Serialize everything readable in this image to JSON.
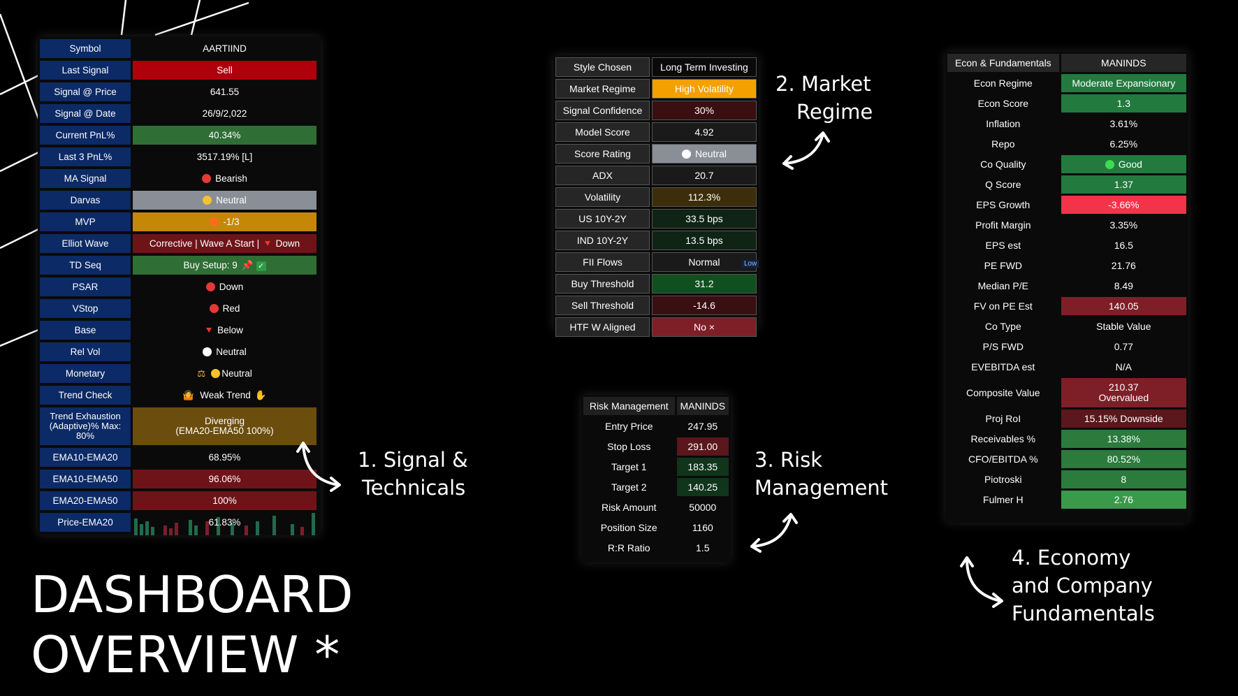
{
  "title_line1": "DASHBOARD",
  "title_line2": "OVERVIEW *",
  "captions": {
    "c1a": "1. Signal &",
    "c1b": "Technicals",
    "c2a": "2. Market",
    "c2b": "Regime",
    "c3a": "3. Risk",
    "c3b": "Management",
    "c4a": "4. Economy",
    "c4b": "and Company",
    "c4c": "Fundamentals"
  },
  "signal_table": {
    "header": {
      "label": "Symbol",
      "value": "AARTIIND"
    },
    "rows": [
      {
        "label": "Last Signal",
        "value": "Sell"
      },
      {
        "label": "Signal @ Price",
        "value": "641.55"
      },
      {
        "label": "Signal @ Date",
        "value": "26/9/2,022"
      },
      {
        "label": "Current PnL%",
        "value": "40.34%"
      },
      {
        "label": "Last 3 PnL%",
        "value": "3517.19% [L]"
      },
      {
        "label": "MA Signal",
        "value": "Bearish"
      },
      {
        "label": "Darvas",
        "value": "Neutral"
      },
      {
        "label": "MVP",
        "value": "-1/3"
      },
      {
        "label": "Elliot Wave",
        "value": "Corrective | Wave A Start |",
        "extra": "Down"
      },
      {
        "label": "TD Seq",
        "value": "Buy Setup: 9"
      },
      {
        "label": "PSAR",
        "value": "Down"
      },
      {
        "label": "VStop",
        "value": "Red"
      },
      {
        "label": "Base",
        "value": "Below"
      },
      {
        "label": "Rel Vol",
        "value": "Neutral"
      },
      {
        "label": "Monetary",
        "value": "Neutral"
      },
      {
        "label": "Trend Check",
        "value": "Weak Trend"
      },
      {
        "label": "Trend Exhaustion (Adaptive)% Max: 80%",
        "value": "Diverging\n(EMA20-EMA50 100%)"
      },
      {
        "label": "EMA10-EMA20",
        "value": "68.95%"
      },
      {
        "label": "EMA10-EMA50",
        "value": "96.06%"
      },
      {
        "label": "EMA20-EMA50",
        "value": "100%"
      },
      {
        "label": "Price-EMA20",
        "value": "61.83%"
      }
    ]
  },
  "regime_table": {
    "rows": [
      {
        "label": "Style Chosen",
        "value": "Long Term Investing"
      },
      {
        "label": "Market Regime",
        "value": "High Volatility"
      },
      {
        "label": "Signal Confidence",
        "value": "30%"
      },
      {
        "label": "Model Score",
        "value": "4.92"
      },
      {
        "label": "Score Rating",
        "value": "Neutral"
      },
      {
        "label": "ADX",
        "value": "20.7"
      },
      {
        "label": "Volatility",
        "value": "112.3%"
      },
      {
        "label": "US 10Y-2Y",
        "value": "33.5 bps"
      },
      {
        "label": "IND 10Y-2Y",
        "value": "13.5 bps"
      },
      {
        "label": "FII Flows",
        "value": "Normal"
      },
      {
        "label": "Buy Threshold",
        "value": "31.2"
      },
      {
        "label": "Sell Threshold",
        "value": "-14.6"
      },
      {
        "label": "HTF W Aligned",
        "value": "No ×"
      }
    ],
    "low_tag": "Low"
  },
  "risk_table": {
    "header": {
      "label": "Risk Management",
      "value": "MANINDS"
    },
    "rows": [
      {
        "label": "Entry Price",
        "value": "247.95"
      },
      {
        "label": "Stop Loss",
        "value": "291.00"
      },
      {
        "label": "Target 1",
        "value": "183.35"
      },
      {
        "label": "Target 2",
        "value": "140.25"
      },
      {
        "label": "Risk Amount",
        "value": "50000"
      },
      {
        "label": "Position Size",
        "value": "1160"
      },
      {
        "label": "R:R Ratio",
        "value": "1.5"
      }
    ]
  },
  "econ_table": {
    "header": {
      "label": "Econ & Fundamentals",
      "value": "MANINDS"
    },
    "rows": [
      {
        "label": "Econ Regime",
        "value": "Moderate Expansionary"
      },
      {
        "label": "Econ Score",
        "value": "1.3"
      },
      {
        "label": "Inflation",
        "value": "3.61%"
      },
      {
        "label": "Repo",
        "value": "6.25%"
      },
      {
        "label": "Co Quality",
        "value": "Good"
      },
      {
        "label": "Q Score",
        "value": "1.37"
      },
      {
        "label": "EPS Growth",
        "value": "-3.66%"
      },
      {
        "label": "Profit Margin",
        "value": "3.35%"
      },
      {
        "label": "EPS est",
        "value": "16.5"
      },
      {
        "label": "PE FWD",
        "value": "21.76"
      },
      {
        "label": "Median P/E",
        "value": "8.49"
      },
      {
        "label": "FV on PE Est",
        "value": "140.05"
      },
      {
        "label": "Co Type",
        "value": "Stable Value"
      },
      {
        "label": "P/S FWD",
        "value": "0.77"
      },
      {
        "label": "EVEBITDA est",
        "value": "N/A"
      },
      {
        "label": "Composite Value",
        "value": "210.37\nOvervalued"
      },
      {
        "label": "Proj RoI",
        "value": "15.15% Downside"
      },
      {
        "label": "Receivables %",
        "value": "13.38%"
      },
      {
        "label": "CFO/EBITDA %",
        "value": "80.52%"
      },
      {
        "label": "Piotroski",
        "value": "8"
      },
      {
        "label": "Fulmer H",
        "value": "2.76"
      }
    ]
  },
  "colors": {
    "label_blue": "#0c2a66",
    "sell_red": "#b0000b",
    "pnl_green": "#2f6e35",
    "neutral_gray": "#8a8e97",
    "mvp_orange": "#c58806",
    "maroon": "#6e1419",
    "exhaustion_brown": "#6b4d0d",
    "high_vol": "#f4a100",
    "bright_red": "#f2334a",
    "green": "#237a3e",
    "dark_red_cell": "#7e1f28",
    "dot_red": "#e53935",
    "dot_yellow": "#f7c22b",
    "dot_orange": "#ff6b1a",
    "dot_green": "#3ddc53"
  }
}
